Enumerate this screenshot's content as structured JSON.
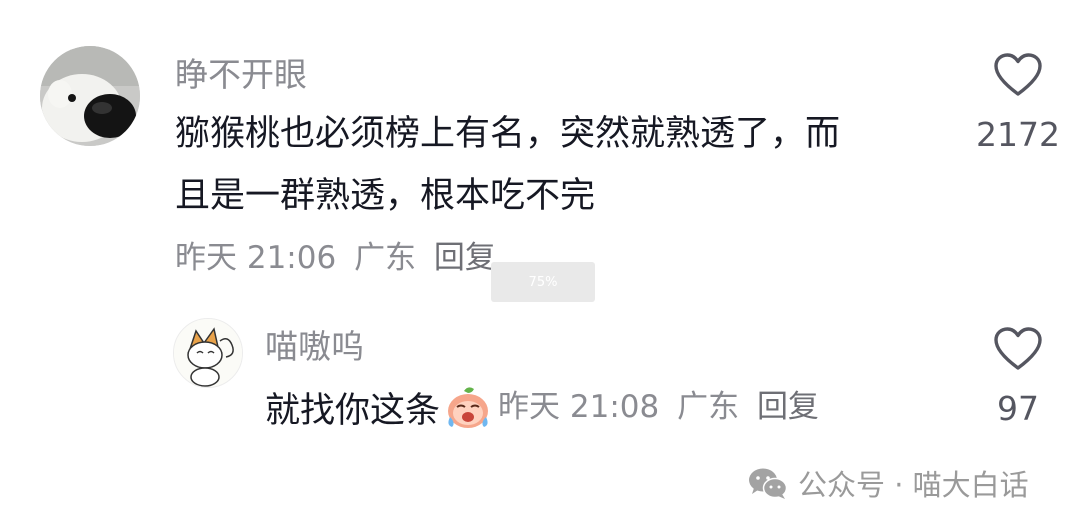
{
  "comments": [
    {
      "username": "睁不开眼",
      "text_line1": "猕猴桃也必须榜上有名，突然就熟透了，而",
      "text_line2": "且是一群熟透，根本吃不完",
      "time": "昨天 21:06",
      "location": "广东",
      "reply_label": "回复",
      "like_count": "2172",
      "avatar_icon": "polar-bear-avatar"
    }
  ],
  "replies": [
    {
      "username": "喵嗷呜",
      "text": "就找你这条",
      "emoji_icon": "crying-face-emoji",
      "time": "昨天 21:08",
      "location": "广东",
      "reply_label": "回复",
      "like_count": "97",
      "avatar_icon": "cartoon-cat-avatar"
    }
  ],
  "zoom_badge": "75%",
  "watermark": {
    "text": "公众号 · 喵大白话",
    "icon": "wechat-icon"
  },
  "colors": {
    "text_primary": "#161823",
    "text_secondary": "#8a8b91",
    "like_icon": "#555660"
  }
}
